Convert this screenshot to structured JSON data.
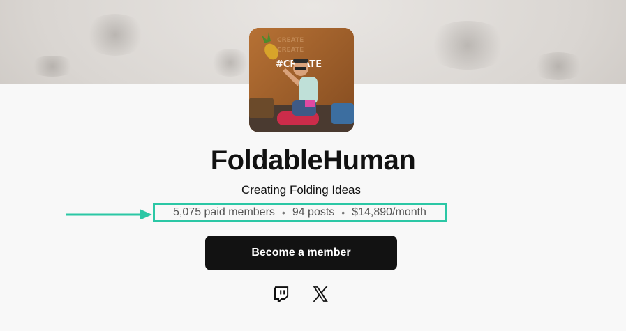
{
  "creator": {
    "name": "FoldableHuman",
    "tagline": "Creating Folding Ideas"
  },
  "stats": {
    "members": "5,075 paid members",
    "posts": "94 posts",
    "earnings": "$14,890/month",
    "separator": "•"
  },
  "cta": {
    "label": "Become a member"
  },
  "social": [
    {
      "name": "Twitch",
      "icon": "twitch-icon"
    },
    {
      "name": "X",
      "icon": "x-icon"
    }
  ],
  "highlight_color": "#2bc7a5",
  "avatar": {
    "sign_text": "#CREATE"
  }
}
